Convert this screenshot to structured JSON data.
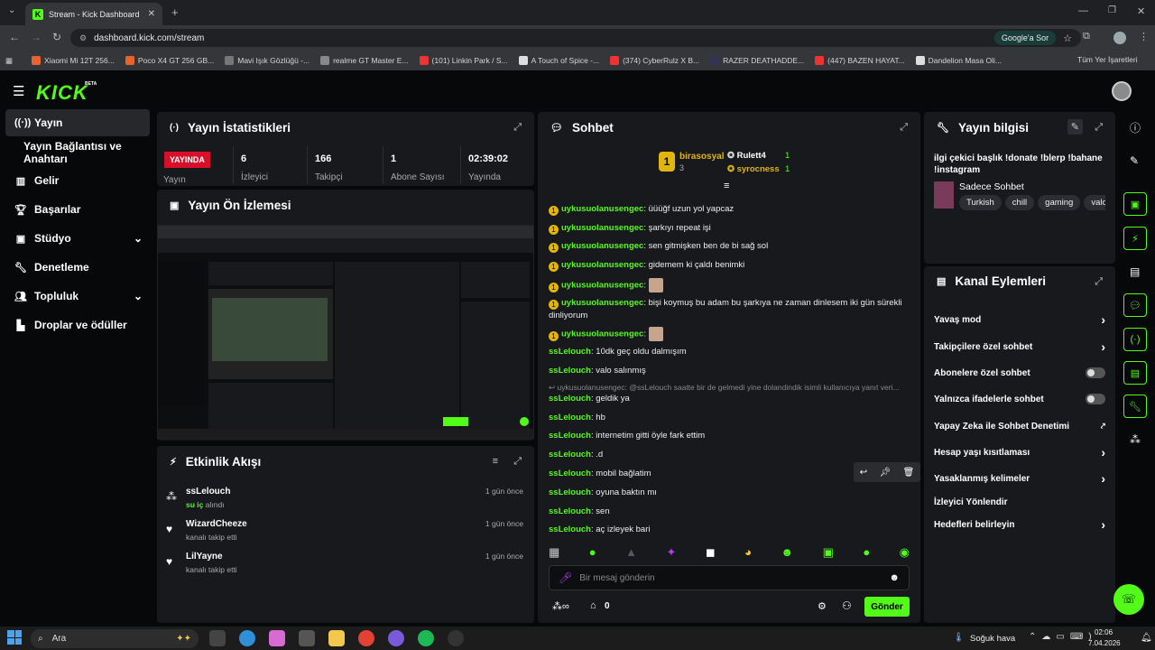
{
  "browser": {
    "tab_title": "Stream - Kick Dashboard",
    "url": "dashboard.kick.com/stream",
    "google_btn": "Google'a Sor",
    "bookmarks": [
      "Xiaomi Mi 12T 256...",
      "Poco X4 GT 256 GB...",
      "Mavi Işık Gözlüğü -...",
      "realme GT Master E...",
      "(101) Linkin Park / S...",
      "A Touch of Spice -...",
      "(374) CyberRulz X B...",
      "RAZER DEATHADDE...",
      "(447) BAZEN HAYAT...",
      "Dandelion Masa Oli..."
    ],
    "all_bookmarks": "Tüm Yer İşaretleri"
  },
  "brand": {
    "logo": "KICK",
    "beta": "BETA"
  },
  "sidebar": {
    "items": [
      "Yayın",
      "Yayın Bağlantısı ve Anahtarı",
      "Gelir",
      "Başarılar",
      "Stüdyo",
      "Denetleme",
      "Topluluk",
      "Droplar ve ödüller"
    ]
  },
  "stats": {
    "title": "Yayın İstatistikleri",
    "live": "YAYINDA",
    "live_label": "Yayın",
    "items": [
      {
        "value": "6",
        "label": "İzleyici"
      },
      {
        "value": "166",
        "label": "Takipçi"
      },
      {
        "value": "1",
        "label": "Abone Sayısı"
      },
      {
        "value": "02:39:02",
        "label": "Yayında"
      }
    ]
  },
  "preview": {
    "title": "Yayın Ön İzlemesi"
  },
  "events": {
    "title": "Etkinlik Akışı",
    "items": [
      {
        "name": "ssLelouch",
        "sub": "su iç",
        "sub2": "alındı",
        "time": "1 gün önce"
      },
      {
        "name": "WizardCheeze",
        "sub": "kanalı takip etti",
        "time": "1 gün önce"
      },
      {
        "name": "LilYayne",
        "sub": "kanalı takip etti",
        "time": "1 gün önce"
      }
    ]
  },
  "chat": {
    "title": "Sohbet",
    "top": [
      {
        "rank": "1",
        "name": "birasosyal",
        "count": "3"
      },
      {
        "rank": "",
        "name": "Rulett4",
        "count": "1"
      },
      {
        "rank": "",
        "name": "syrocness",
        "count": "1"
      }
    ],
    "messages": [
      {
        "user": "uykusuolanusengec",
        "text": "üüüğf uzun yol yapcaz"
      },
      {
        "user": "uykusuolanusengec",
        "text": "şarkıyı repeat işi"
      },
      {
        "user": "uykusuolanusengec",
        "text": "sen gitmişken ben de bi sağ sol"
      },
      {
        "user": "uykusuolanusengec",
        "text": "gidemem ki çaldı benimki"
      },
      {
        "user": "uykusuolanusengec",
        "text": ""
      },
      {
        "user": "uykusuolanusengec",
        "text": "bişi koymuş bu adam bu şarkıya ne zaman dinlesem iki gün sürekli dinliyorum"
      },
      {
        "user": "uykusuolanusengec",
        "text": ""
      },
      {
        "user": "ssLelouch",
        "text": "10dk geç oldu dalmışım"
      },
      {
        "user": "ssLelouch",
        "text": "valo salınmış"
      },
      {
        "user": "",
        "text": "uykusuolanusengec: @ssLelouch saatte bir de gelmedi yine dolandindik isimli kullanıcıya yanıt veri..."
      },
      {
        "user": "ssLelouch",
        "text": "geldik ya"
      },
      {
        "user": "ssLelouch",
        "text": "hb"
      },
      {
        "user": "ssLelouch",
        "text": "internetim gitti öyle fark ettim"
      },
      {
        "user": "ssLelouch",
        "text": ".d"
      },
      {
        "user": "ssLelouch",
        "text": "mobil bağlatim"
      },
      {
        "user": "ssLelouch",
        "text": "oyuna baktın mı"
      },
      {
        "user": "ssLelouch",
        "text": "sen"
      },
      {
        "user": "ssLelouch",
        "text": "aç izleyek bari"
      }
    ],
    "input_placeholder": "Bir mesaj gönderin",
    "points": "0",
    "send": "Gönder"
  },
  "info": {
    "title": "Yayın bilgisi",
    "stream_title": "ilgi çekici başlık !donate !blerp !bahane !instagram",
    "category": "Sadece Sohbet",
    "tags": [
      "Turkish",
      "chill",
      "gaming",
      "valora"
    ]
  },
  "actions": {
    "title": "Kanal Eylemleri",
    "items": [
      {
        "label": "Yavaş mod",
        "kind": "chevron"
      },
      {
        "label": "Takipçilere özel sohbet",
        "kind": "chevron"
      },
      {
        "label": "Abonelere özel sohbet",
        "kind": "toggle"
      },
      {
        "label": "Yalnızca ifadelerle sohbet",
        "kind": "toggle"
      },
      {
        "label": "Yapay Zeka ile Sohbet Denetimi",
        "kind": "ext"
      },
      {
        "label": "Hesap yaşı kısıtlaması",
        "kind": "chevron"
      },
      {
        "label": "Yasaklanmış kelimeler",
        "kind": "chevron"
      },
      {
        "label": "İzleyici Yönlendir",
        "kind": "none"
      },
      {
        "label": "Hedefleri belirleyin",
        "kind": "chevron"
      }
    ]
  },
  "taskbar": {
    "search": "Ara",
    "weather": "Soğuk hava",
    "time": "02:06",
    "date": "7.04.2026"
  }
}
